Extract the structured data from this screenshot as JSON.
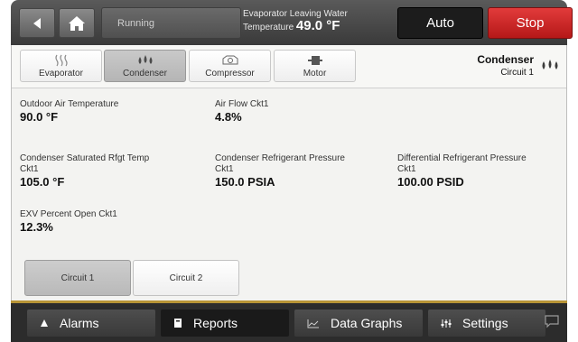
{
  "header": {
    "status_label": "Running",
    "evap_label_line1": "Evaporator Leaving Water",
    "evap_label_line2": "Temperature",
    "evap_value": "49.0 °F",
    "mode_label": "Auto",
    "stop_label": "Stop",
    "stop_color": "#d42a2a"
  },
  "tabs": [
    {
      "label": "Evaporator",
      "icon": "heat-waves-icon"
    },
    {
      "label": "Condenser",
      "icon": "droplets-icon"
    },
    {
      "label": "Compressor",
      "icon": "compressor-icon"
    },
    {
      "label": "Motor",
      "icon": "motor-icon"
    }
  ],
  "panel": {
    "title": "Condenser",
    "subtitle": "Circuit 1",
    "icon": "droplets-icon"
  },
  "fields": {
    "outdoor_air_temp": {
      "label": "Outdoor Air Temperature",
      "value": "90.0 °F"
    },
    "air_flow": {
      "label": "Air Flow Ckt1",
      "value": "4.8%"
    },
    "cond_sat_temp": {
      "label_line1": "Condenser Saturated Rfgt Temp",
      "label_line2": "Ckt1",
      "value": "105.0 °F"
    },
    "cond_pressure": {
      "label_line1": "Condenser Refrigerant Pressure",
      "label_line2": "Ckt1",
      "value": "150.0 PSIA"
    },
    "diff_pressure": {
      "label_line1": "Differential Refrigerant Pressure",
      "label_line2": "Ckt1",
      "value": "100.00 PSID"
    },
    "exv_open": {
      "label": "EXV Percent Open Ckt1",
      "value": "12.3%"
    }
  },
  "circuits": [
    {
      "label": "Circuit 1",
      "selected": true
    },
    {
      "label": "Circuit 2",
      "selected": false
    }
  ],
  "bottom_nav": [
    {
      "label": "Alarms",
      "icon": "alarm-triangle-icon"
    },
    {
      "label": "Reports",
      "icon": "report-icon"
    },
    {
      "label": "Data Graphs",
      "icon": "graph-icon"
    },
    {
      "label": "Settings",
      "icon": "sliders-icon"
    }
  ],
  "accent_color": "#b89436"
}
